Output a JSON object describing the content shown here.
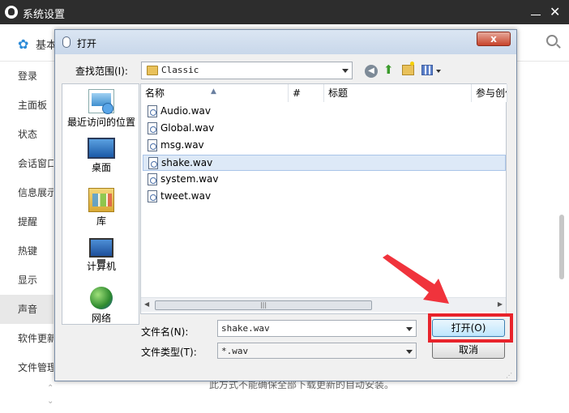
{
  "app": {
    "title": "系统设置",
    "section_label": "基本",
    "sidebar": [
      "登录",
      "主面板",
      "状态",
      "会话窗口",
      "信息展示",
      "提醒",
      "热键",
      "显示",
      "声音",
      "软件更新",
      "文件管理"
    ],
    "active_item": "声音",
    "background_text": "此方式不能确保全部下载更新的自动安装。"
  },
  "dialog": {
    "title": "打开",
    "lookin_label": "查找范围(I):",
    "lookin_value": "Classic",
    "places": [
      "最近访问的位置",
      "桌面",
      "库",
      "计算机",
      "网络"
    ],
    "columns": [
      "名称",
      "#",
      "标题",
      "参与创作"
    ],
    "files": [
      "Audio.wav",
      "Global.wav",
      "msg.wav",
      "shake.wav",
      "system.wav",
      "tweet.wav"
    ],
    "selected_file": "shake.wav",
    "filename_label": "文件名(N):",
    "filename_value": "shake.wav",
    "filetype_label": "文件类型(T):",
    "filetype_value": "*.wav",
    "open_button": "打开(O)",
    "cancel_button": "取消",
    "close_glyph": "x"
  },
  "colors": {
    "highlight": "#e8232b",
    "selection": "#dde9f7",
    "app_titlebar": "#2d2d2d"
  }
}
